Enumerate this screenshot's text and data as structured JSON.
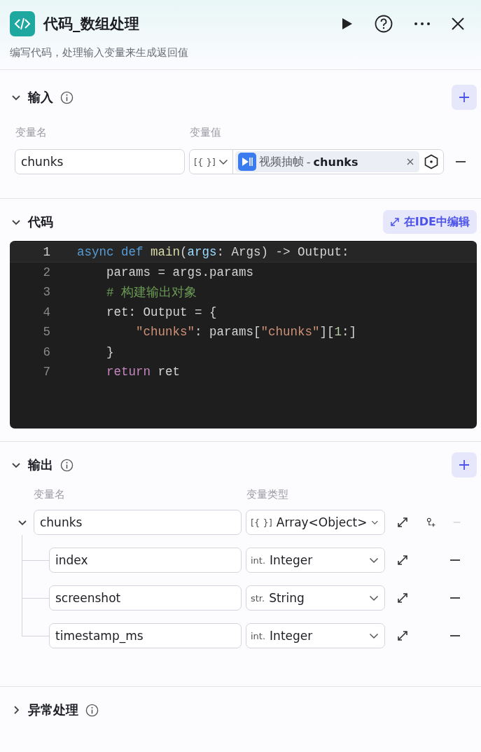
{
  "header": {
    "title": "代码_数组处理",
    "description": "编写代码，处理输入变量来生成返回值"
  },
  "input": {
    "title": "输入",
    "expanded": true,
    "columns": [
      "变量名",
      "变量值"
    ],
    "rows": [
      {
        "name": "chunks",
        "type_prefix": "[{ }]",
        "source_node": "视频抽帧",
        "separator": "-",
        "source_var": "chunks"
      }
    ]
  },
  "code": {
    "title": "代码",
    "expanded": true,
    "ide_button": "在IDE中编辑",
    "lines": [
      {
        "number": "1",
        "current": true,
        "tokens": [
          {
            "text": "async def ",
            "kind": "keyword"
          },
          {
            "text": "main",
            "kind": "function"
          },
          {
            "text": "(",
            "kind": "plain"
          },
          {
            "text": "args",
            "kind": "param"
          },
          {
            "text": ": Args) ",
            "kind": "plain"
          },
          {
            "text": "->",
            "kind": "plain"
          },
          {
            "text": " Output:",
            "kind": "plain"
          }
        ]
      },
      {
        "number": "2",
        "current": false,
        "tokens": [
          {
            "text": "    params ",
            "kind": "plain"
          },
          {
            "text": "=",
            "kind": "operator"
          },
          {
            "text": " args.params",
            "kind": "plain"
          }
        ]
      },
      {
        "number": "3",
        "current": false,
        "tokens": [
          {
            "text": "    # 构建输出对象",
            "kind": "comment"
          }
        ]
      },
      {
        "number": "4",
        "current": false,
        "tokens": [
          {
            "text": "    ret: Output ",
            "kind": "plain"
          },
          {
            "text": "=",
            "kind": "operator"
          },
          {
            "text": " {",
            "kind": "plain"
          }
        ]
      },
      {
        "number": "5",
        "current": false,
        "tokens": [
          {
            "text": "        \"chunks\"",
            "kind": "string"
          },
          {
            "text": ": params[",
            "kind": "plain"
          },
          {
            "text": "\"chunks\"",
            "kind": "string"
          },
          {
            "text": "][",
            "kind": "plain"
          },
          {
            "text": "1",
            "kind": "number"
          },
          {
            "text": ":]",
            "kind": "plain"
          }
        ]
      },
      {
        "number": "6",
        "current": false,
        "tokens": [
          {
            "text": "    }",
            "kind": "plain"
          }
        ]
      },
      {
        "number": "7",
        "current": false,
        "tokens": [
          {
            "text": "    return",
            "kind": "control"
          },
          {
            "text": " ret",
            "kind": "plain"
          }
        ]
      }
    ]
  },
  "output": {
    "title": "输出",
    "expanded": true,
    "columns": [
      "变量名",
      "变量类型"
    ],
    "rows": [
      {
        "name": "chunks",
        "type_prefix": "[{ }]",
        "type": "Array<Object>",
        "expanded": true,
        "removable": false,
        "children": [
          {
            "name": "index",
            "type_prefix": "int.",
            "type": "Integer",
            "removable": true
          },
          {
            "name": "screenshot",
            "type_prefix": "str.",
            "type": "String",
            "removable": true
          },
          {
            "name": "timestamp_ms",
            "type_prefix": "int.",
            "type": "Integer",
            "removable": true
          }
        ]
      }
    ]
  },
  "error_handling": {
    "title": "异常处理",
    "expanded": false
  }
}
